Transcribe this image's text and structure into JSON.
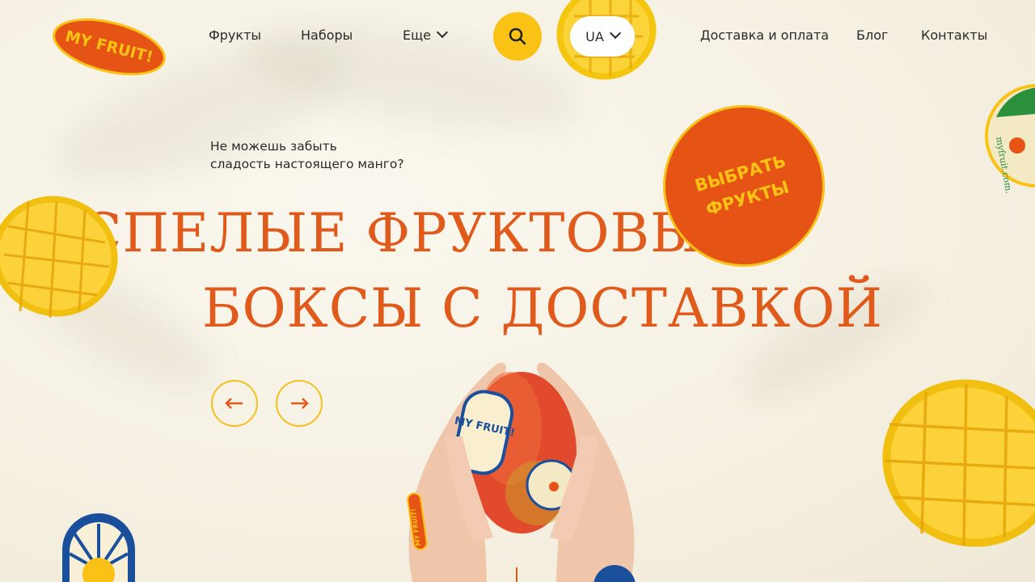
{
  "brand": {
    "logo_text": "MY FRUIT!"
  },
  "nav": {
    "fruits": "Фрукты",
    "sets": "Наборы",
    "more": "Еще",
    "delivery": "Доставка и оплата",
    "blog": "Блог",
    "contacts": "Контакты"
  },
  "lang": {
    "current": "UA"
  },
  "hero": {
    "tagline_line1": "Не можешь забыть",
    "tagline_line2": "сладость настоящего манго?",
    "headline_line1": "СПЕЛЫЕ ФРУКТОВЫЕ",
    "headline_line2": "БОКСЫ С ДОСТАВКОЙ",
    "cta_line1": "ВЫБРАТЬ",
    "cta_line2": "ФРУКТЫ",
    "mango_sticker": "MY FRUIT!",
    "hand_sticker": "MY FRUIT!",
    "corner_sticker_text": "myfruit.com.ua"
  },
  "colors": {
    "accent_orange": "#e05a1c",
    "accent_yellow": "#f9c215",
    "background": "#f7f3e8"
  },
  "icons": {
    "search": "search-icon",
    "prev": "arrow-left-icon",
    "next": "arrow-right-icon",
    "chevron": "chevron-down-icon"
  }
}
